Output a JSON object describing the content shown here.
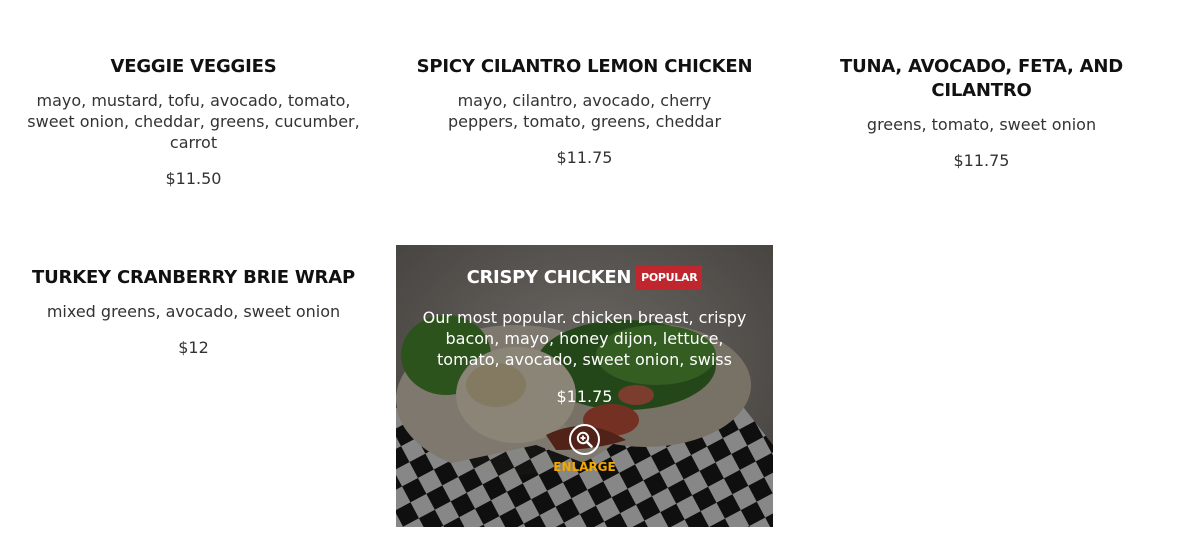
{
  "items": [
    {
      "title": "VEGGIE VEGGIES",
      "description": "mayo, mustard, tofu, avocado, tomato, sweet onion, cheddar, greens, cucumber, carrot",
      "price": "$11.50"
    },
    {
      "title": "SPICY CILANTRO LEMON CHICKEN",
      "description": "mayo, cilantro, avocado, cherry peppers, tomato, greens, cheddar",
      "price": "$11.75"
    },
    {
      "title": "TUNA, AVOCADO, FETA, AND CILANTRO",
      "description": "greens, tomato, sweet onion",
      "price": "$11.75"
    },
    {
      "title": "TURKEY CRANBERRY BRIE WRAP",
      "description": "mixed greens, avocado, sweet onion",
      "price": "$12"
    }
  ],
  "featured": {
    "title": "CRISPY CHICKEN",
    "badge": "POPULAR",
    "description": "Our most popular. chicken breast, crispy bacon, mayo, honey dijon, lettuce, tomato, avocado, sweet onion, swiss",
    "price": "$11.75",
    "enlarge_label": "ENLARGE",
    "enlarge_icon": "zoom-in-icon"
  },
  "colors": {
    "badge": "#c0262d",
    "enlarge": "#f2a900",
    "title": "#111111",
    "text": "#333333"
  }
}
